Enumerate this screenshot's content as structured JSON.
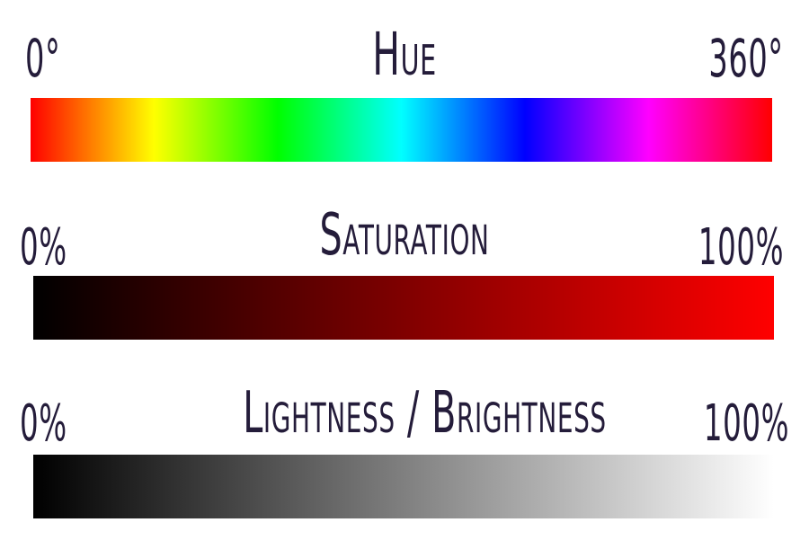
{
  "scales": [
    {
      "title": "Hue",
      "min_label": "0°",
      "max_label": "360°",
      "gradient_colors": [
        "#ff0000",
        "#ff8000",
        "#ffff00",
        "#80ff00",
        "#00ff00",
        "#00ff80",
        "#00ffff",
        "#0080ff",
        "#0000ff",
        "#8000ff",
        "#ff00ff",
        "#ff0080",
        "#ff0000"
      ]
    },
    {
      "title": "Saturation",
      "min_label": "0%",
      "max_label": "100%",
      "gradient_colors": [
        "#000000",
        "#ff0000"
      ]
    },
    {
      "title": "Lightness / Brightness",
      "min_label": "0%",
      "max_label": "100%",
      "gradient_colors": [
        "#000000",
        "#ffffff"
      ]
    }
  ]
}
